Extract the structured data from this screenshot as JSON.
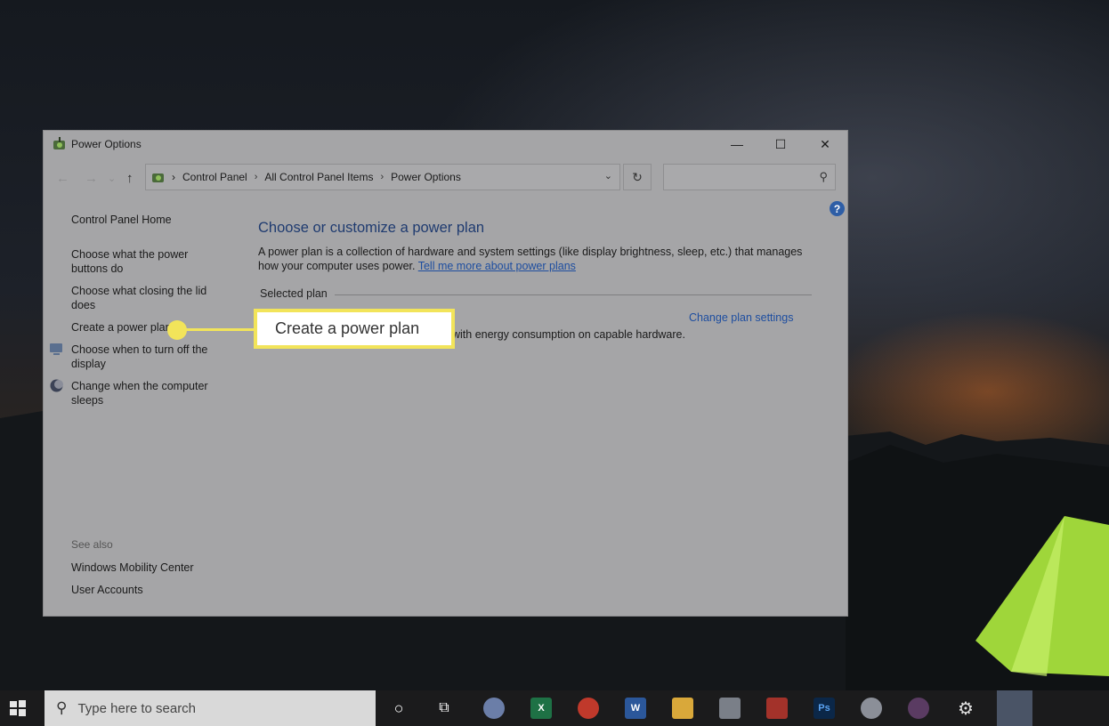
{
  "window": {
    "title": "Power Options",
    "controls": {
      "minimize": "—",
      "maximize": "☐",
      "close": "✕"
    }
  },
  "navigation": {
    "back_icon": "←",
    "forward_icon": "→",
    "recent_icon": "⌄",
    "up_icon": "↑",
    "breadcrumb": [
      "Control Panel",
      "All Control Panel Items",
      "Power Options"
    ],
    "breadcrumb_separator": "›",
    "dropdown_icon": "⌄",
    "refresh_icon": "↻",
    "search_placeholder": "",
    "search_icon": "⚲"
  },
  "sidebar": {
    "home": "Control Panel Home",
    "items": [
      "Choose what the power buttons do",
      "Choose what closing the lid does",
      "Create a power plan",
      "Choose when to turn off the display",
      "Change when the computer sleeps"
    ],
    "see_also_label": "See also",
    "see_also": [
      "Windows Mobility Center",
      "User Accounts"
    ]
  },
  "main": {
    "heading": "Choose or customize a power plan",
    "description": "A power plan is a collection of hardware and system settings (like display brightness, sleep, etc.) that manages how your computer uses power.",
    "learn_more_link": "Tell me more about power plans",
    "selected_plan_label": "Selected plan",
    "change_plan_link": "Change plan settings",
    "plan_description_fragment": "with energy consumption on capable hardware."
  },
  "callout": {
    "text": "Create a power plan"
  },
  "help_icon": "?",
  "taskbar": {
    "search_placeholder": "Type here to search",
    "cortana_icon": "○",
    "taskview_icon": "⧉",
    "apps": [
      "paint-icon",
      "excel-icon",
      "chrome-icon",
      "word-icon",
      "file-explorer-icon",
      "network-icon",
      "tool-icon",
      "photoshop-icon",
      "paint-palette-icon",
      "slack-icon",
      "settings-icon",
      "mail-icon"
    ],
    "app_labels": {
      "excel": "X",
      "word": "W",
      "photoshop": "Ps",
      "settings": "⚙"
    }
  },
  "colors": {
    "highlight": "#f2e45a",
    "link": "#1e4ea0",
    "heading": "#1f3b70"
  }
}
